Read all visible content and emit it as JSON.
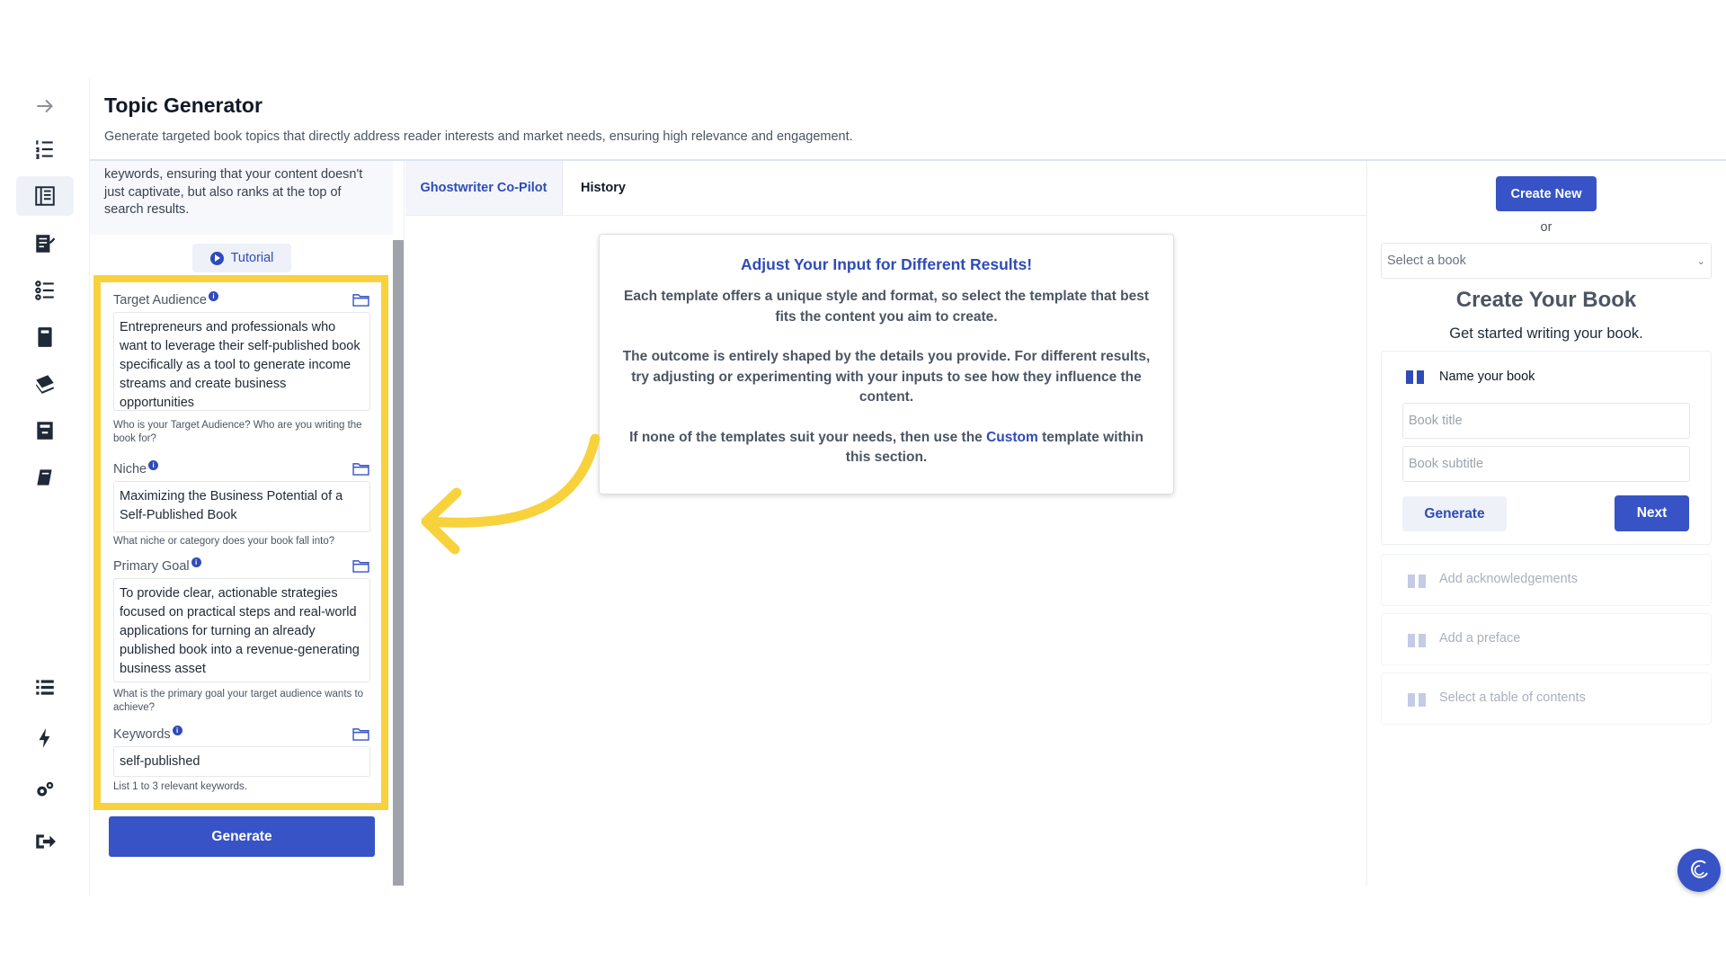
{
  "header": {
    "title": "Topic Generator",
    "description": "Generate targeted book topics that directly address reader interests and market needs, ensuring high relevance and engagement."
  },
  "left_panel": {
    "intro_text": "keywords, ensuring that your content doesn't just captivate, but also ranks at the top of search results.",
    "tutorial_label": "Tutorial",
    "fields": {
      "target_audience": {
        "label": "Target Audience",
        "value": "Entrepreneurs and professionals who want to leverage their self-published book specifically as a tool to generate income streams and create business opportunities",
        "hint": "Who is your Target Audience? Who are you writing the book for?"
      },
      "niche": {
        "label": "Niche",
        "value": "Maximizing the Business Potential of a Self-Published Book",
        "hint": "What niche or category does your book fall into?"
      },
      "primary_goal": {
        "label": "Primary Goal",
        "value": "To provide clear, actionable strategies focused on practical steps and real-world applications for turning an already published book into a revenue-generating business asset",
        "hint": "What is the primary goal your target audience wants to achieve?"
      },
      "keywords": {
        "label": "Keywords",
        "value": "self-published",
        "hint": "List 1 to 3 relevant keywords."
      }
    },
    "generate_label": "Generate"
  },
  "tabs": [
    {
      "label": "Ghostwriter Co-Pilot",
      "active": true
    },
    {
      "label": "History",
      "active": false
    }
  ],
  "info_card": {
    "title": "Adjust Your Input for Different Results!",
    "p1": "Each template offers a unique style and format, so select the template that best fits the content you aim to create.",
    "p2": "The outcome is entirely shaped by the details you provide. For different results, try adjusting or experimenting with your inputs to see how they influence the content.",
    "p3_before": "If none of the templates suit your needs, then use the ",
    "p3_link": "Custom",
    "p3_after": " template within this section."
  },
  "right_panel": {
    "create_new_label": "Create New",
    "or_label": "or",
    "select_book_placeholder": "Select a book",
    "title": "Create Your Book",
    "subtitle": "Get started writing your book.",
    "step_name_label": "Name your book",
    "book_title_placeholder": "Book title",
    "book_subtitle_placeholder": "Book subtitle",
    "generate_label": "Generate",
    "next_label": "Next",
    "steps": [
      "Add acknowledgements",
      "Add a preface",
      "Select a table of contents"
    ]
  },
  "icons": {
    "rail": [
      "arrow-right-icon",
      "numbered-list-icon",
      "book-layout-icon",
      "edit-document-icon",
      "checklist-icon",
      "notebook-icon",
      "books-stack-icon",
      "archive-icon",
      "book-icon",
      "list-icon",
      "lightning-icon",
      "gears-icon",
      "sign-out-icon"
    ]
  },
  "colors": {
    "primary": "#3753c6",
    "highlight": "#f8d23c",
    "accent_text": "#2f4bb8"
  }
}
